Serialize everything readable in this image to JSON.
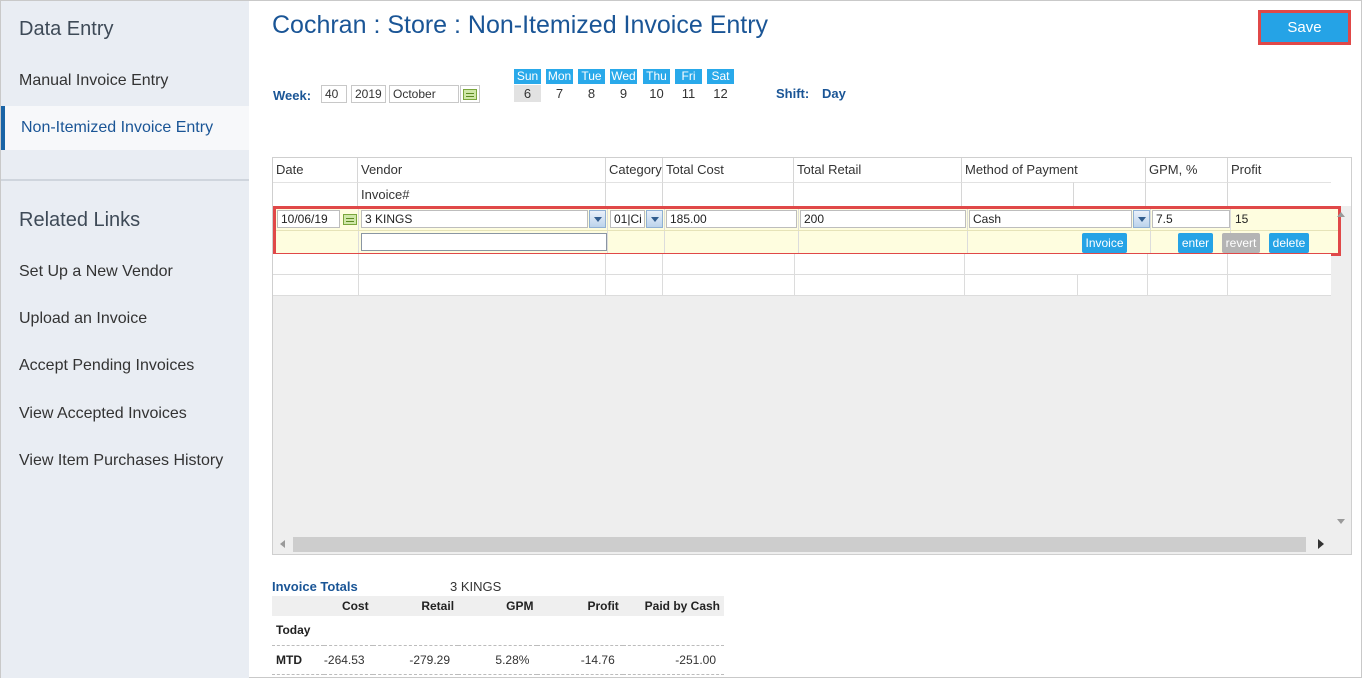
{
  "sidebar": {
    "heading_data_entry": "Data Entry",
    "items": [
      {
        "label": "Manual Invoice Entry"
      },
      {
        "label": "Non-Itemized Invoice Entry"
      }
    ],
    "heading_related": "Related Links",
    "links": [
      {
        "label": "Set Up a New Vendor"
      },
      {
        "label": "Upload an Invoice"
      },
      {
        "label": "Accept Pending Invoices"
      },
      {
        "label": "View Accepted Invoices"
      },
      {
        "label": "View Item Purchases History"
      }
    ]
  },
  "header": {
    "title": "Cochran : Store : Non-Itemized Invoice Entry",
    "save_label": "Save"
  },
  "week": {
    "label": "Week:",
    "week_number": "40",
    "year": "2019",
    "month": "October",
    "days": [
      {
        "name": "Sun",
        "num": "6"
      },
      {
        "name": "Mon",
        "num": "7"
      },
      {
        "name": "Tue",
        "num": "8"
      },
      {
        "name": "Wed",
        "num": "9"
      },
      {
        "name": "Thu",
        "num": "10"
      },
      {
        "name": "Fri",
        "num": "11"
      },
      {
        "name": "Sat",
        "num": "12"
      }
    ],
    "shift_label": "Shift:",
    "shift_value": "Day"
  },
  "grid": {
    "columns": {
      "date": "Date",
      "vendor": "Vendor",
      "invoice_no": "Invoice#",
      "category": "Category",
      "total_cost": "Total Cost",
      "total_retail": "Total Retail",
      "method": "Method of Payment",
      "gpm": "GPM, %",
      "profit": "Profit"
    },
    "entry": {
      "date": "10/06/19",
      "vendor": "3 KINGS",
      "category": "01|Ci",
      "total_cost": "185.00",
      "total_retail": "200",
      "method": "Cash",
      "gpm": "7.5",
      "profit": "15",
      "invoice_number": ""
    },
    "buttons": {
      "invoice": "Invoice",
      "enter": "enter",
      "revert": "revert",
      "delete": "delete"
    }
  },
  "totals": {
    "title": "Invoice Totals",
    "vendor": "3 KINGS",
    "headers": [
      "Cost",
      "Retail",
      "GPM",
      "Profit",
      "Paid by Cash"
    ],
    "rows": [
      {
        "label": "Today",
        "cost": "",
        "retail": "",
        "gpm": "",
        "profit": "",
        "paid": ""
      },
      {
        "label": "MTD",
        "cost": "-264.53",
        "retail": "-279.29",
        "gpm": "5.28%",
        "profit": "-14.76",
        "paid": "-251.00"
      }
    ]
  },
  "colors": {
    "accent": "#25a3e6",
    "title_blue": "#1a5596",
    "highlight_red": "#e04848",
    "active_row": "#fefddf"
  }
}
